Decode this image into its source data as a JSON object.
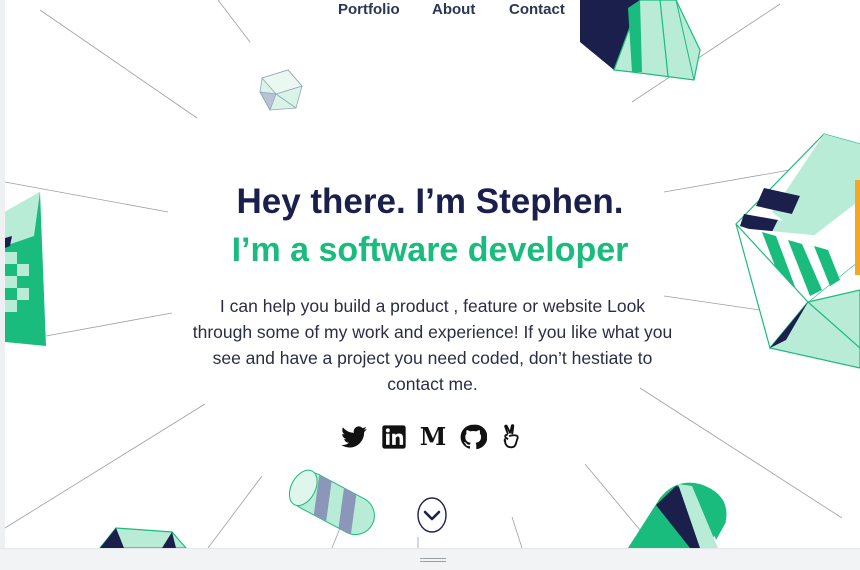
{
  "nav": {
    "items": [
      {
        "label": "Portfolio"
      },
      {
        "label": "About"
      },
      {
        "label": "Contact"
      }
    ]
  },
  "hero": {
    "title": "Hey there. I’m Stephen.",
    "subtitle": "I’m a software developer",
    "description": "I can help you build a product , feature or website Look through some of my work and experience! If you like what you see and have a project you need coded, don’t hestiate to contact me.",
    "description_lines": [
      "I can help you build a product , feature or website Look",
      "through some of my work and experience! If you like what you",
      "see and have a project you need coded, don’t hestiate to",
      "contact me."
    ]
  },
  "socials": [
    {
      "icon": "twitter-icon"
    },
    {
      "icon": "linkedin-icon"
    },
    {
      "icon": "medium-icon",
      "glyph": "M"
    },
    {
      "icon": "github-icon"
    },
    {
      "icon": "angellist-icon"
    }
  ],
  "scroll": {
    "icon": "chevron-down-icon"
  },
  "colors": {
    "navy": "#1b1f4b",
    "green": "#19bc7c",
    "mint": "#b9ecd7",
    "text": "#2a2e45",
    "accent_orange": "#f5a623"
  }
}
